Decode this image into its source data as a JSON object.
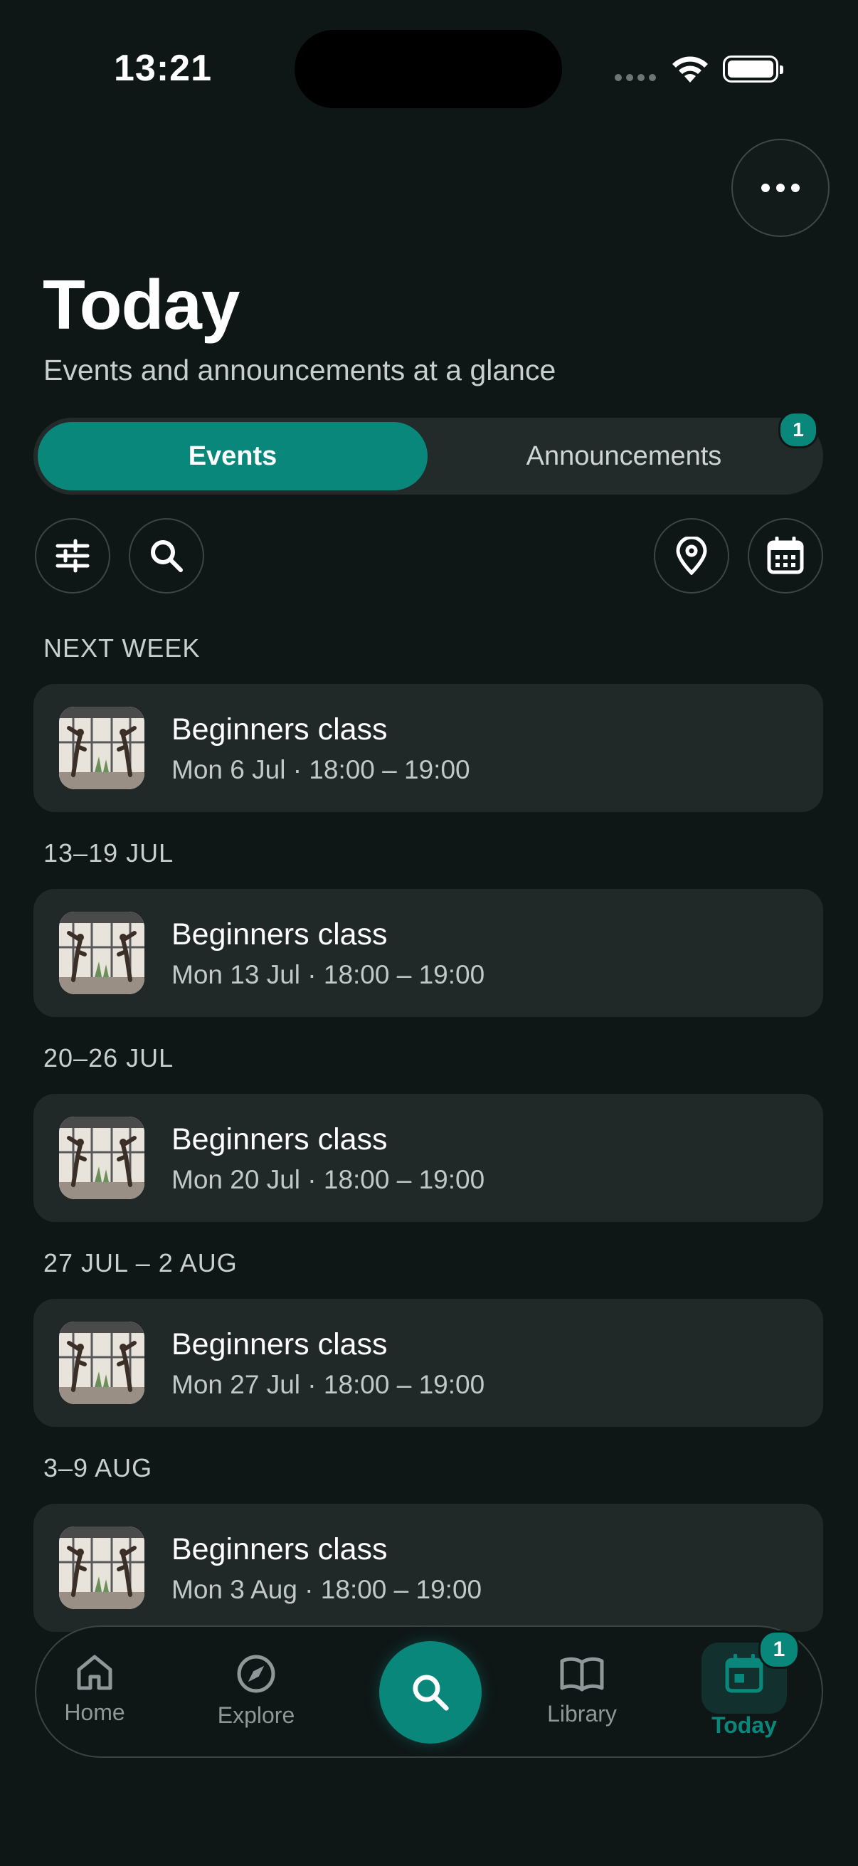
{
  "status_bar": {
    "time": "13:21"
  },
  "header": {
    "title": "Today",
    "subtitle": "Events and announcements at a glance"
  },
  "tabs": {
    "events_label": "Events",
    "announcements_label": "Announcements",
    "announcements_badge": "1"
  },
  "sections": [
    {
      "label": "NEXT WEEK",
      "event": {
        "title": "Beginners class",
        "time": "Mon 6 Jul · 18:00 – 19:00"
      }
    },
    {
      "label": "13–19 JUL",
      "event": {
        "title": "Beginners class",
        "time": "Mon 13 Jul · 18:00 – 19:00"
      }
    },
    {
      "label": "20–26 JUL",
      "event": {
        "title": "Beginners class",
        "time": "Mon 20 Jul · 18:00 – 19:00"
      }
    },
    {
      "label": "27 JUL – 2 AUG",
      "event": {
        "title": "Beginners class",
        "time": "Mon 27 Jul · 18:00 – 19:00"
      }
    },
    {
      "label": "3–9 AUG",
      "event": {
        "title": "Beginners class",
        "time": "Mon 3 Aug · 18:00 – 19:00"
      }
    }
  ],
  "bottom_nav": {
    "home_label": "Home",
    "explore_label": "Explore",
    "library_label": "Library",
    "today_label": "Today",
    "today_badge": "1"
  },
  "colors": {
    "accent": "#0a877b",
    "background": "#0f1616",
    "card": "#212828"
  }
}
